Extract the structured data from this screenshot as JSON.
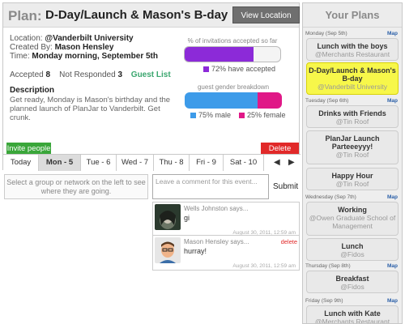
{
  "plan": {
    "label": "Plan:",
    "title": "D-Day/Launch & Mason's B-day",
    "view_location": "View Location Info",
    "location_label": "Location:",
    "location": "@Vanderbilt University",
    "created_label": "Created By:",
    "created_by": "Mason Hensley",
    "time_label": "Time:",
    "time": "Monday morning, September 5th",
    "accepted_label": "Accepted",
    "accepted": "8",
    "not_responded_label": "Not Responded",
    "not_responded": "3",
    "guest_list": "Guest List",
    "description_heading": "Description",
    "description": "Get ready, Monday is Mason's birthday and the planned launch of PlanJar to Vanderbilt. Get crunk.",
    "accepted_caption": "% of invitations accepted so far",
    "accepted_pct": 0.72,
    "accepted_legend": "72% have accepted",
    "gender_caption": "guest gender breakdown",
    "male_pct": 0.75,
    "female_pct": 0.25,
    "male_legend": "75% male",
    "female_legend": "25% female",
    "invite_button": "Invite people",
    "delete_button": "Delete plan",
    "colors": {
      "accepted": "#8c2ad8",
      "male": "#3d9be9",
      "female": "#e01887",
      "invite": "#3aa63a",
      "delete": "#e12929",
      "selected": "#f7f74a"
    }
  },
  "days": {
    "prev": "◀",
    "next": "▶",
    "items": [
      "Today",
      "Mon - 5",
      "Tue - 6",
      "Wed - 7",
      "Thu - 8",
      "Fri - 9",
      "Sat - 10"
    ]
  },
  "network_hint": "Select a group or network on the left to see where they are going.",
  "comment_placeholder": "Leave a comment for this event...",
  "submit_label": "Submit",
  "comments": [
    {
      "author": "Wells Johnston says...",
      "text": "gi",
      "time": "August 30, 2011, 12:59 am"
    },
    {
      "author": "Mason Hensley says...",
      "text": "hurray!",
      "time": "August 30, 2011, 12:59 am",
      "delete": "delete"
    }
  ],
  "sidebar": {
    "title": "Your Plans",
    "map_label": "Map",
    "dates": [
      "Monday (Sep 5th)",
      "Tuesday (Sep 6th)",
      "Wednesday (Sep 7th)",
      "Thursday (Sep 8th)",
      "Friday (Sep 9th)"
    ],
    "plans": [
      {
        "name": "Lunch with the boys",
        "location": "@Merchants Restaurant"
      },
      {
        "name": "D-Day/Launch & Mason's B-day",
        "location": "@Vanderbilt University"
      },
      {
        "name": "Drinks with Friends",
        "location": "@Tin Roof"
      },
      {
        "name": "PlanJar Launch Parteeeyyy!",
        "location": "@Tin Roof"
      },
      {
        "name": "Happy Hour",
        "location": "@Tin Roof"
      },
      {
        "name": "Working",
        "location": "@Owen Graduate School of Management"
      },
      {
        "name": "Lunch",
        "location": "@Fidos"
      },
      {
        "name": "Breakfast",
        "location": "@Fidos"
      },
      {
        "name": "Lunch with Kate",
        "location": "@Merchants Restaurant"
      }
    ]
  }
}
